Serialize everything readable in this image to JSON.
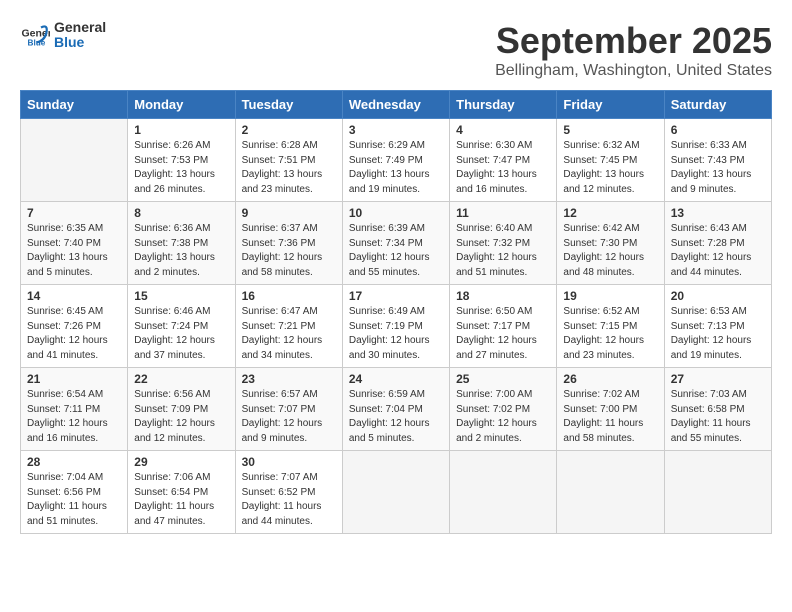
{
  "header": {
    "logo_general": "General",
    "logo_blue": "Blue",
    "month_title": "September 2025",
    "location": "Bellingham, Washington, United States"
  },
  "weekdays": [
    "Sunday",
    "Monday",
    "Tuesday",
    "Wednesday",
    "Thursday",
    "Friday",
    "Saturday"
  ],
  "weeks": [
    [
      {
        "day": "",
        "info": ""
      },
      {
        "day": "1",
        "info": "Sunrise: 6:26 AM\nSunset: 7:53 PM\nDaylight: 13 hours\nand 26 minutes."
      },
      {
        "day": "2",
        "info": "Sunrise: 6:28 AM\nSunset: 7:51 PM\nDaylight: 13 hours\nand 23 minutes."
      },
      {
        "day": "3",
        "info": "Sunrise: 6:29 AM\nSunset: 7:49 PM\nDaylight: 13 hours\nand 19 minutes."
      },
      {
        "day": "4",
        "info": "Sunrise: 6:30 AM\nSunset: 7:47 PM\nDaylight: 13 hours\nand 16 minutes."
      },
      {
        "day": "5",
        "info": "Sunrise: 6:32 AM\nSunset: 7:45 PM\nDaylight: 13 hours\nand 12 minutes."
      },
      {
        "day": "6",
        "info": "Sunrise: 6:33 AM\nSunset: 7:43 PM\nDaylight: 13 hours\nand 9 minutes."
      }
    ],
    [
      {
        "day": "7",
        "info": "Sunrise: 6:35 AM\nSunset: 7:40 PM\nDaylight: 13 hours\nand 5 minutes."
      },
      {
        "day": "8",
        "info": "Sunrise: 6:36 AM\nSunset: 7:38 PM\nDaylight: 13 hours\nand 2 minutes."
      },
      {
        "day": "9",
        "info": "Sunrise: 6:37 AM\nSunset: 7:36 PM\nDaylight: 12 hours\nand 58 minutes."
      },
      {
        "day": "10",
        "info": "Sunrise: 6:39 AM\nSunset: 7:34 PM\nDaylight: 12 hours\nand 55 minutes."
      },
      {
        "day": "11",
        "info": "Sunrise: 6:40 AM\nSunset: 7:32 PM\nDaylight: 12 hours\nand 51 minutes."
      },
      {
        "day": "12",
        "info": "Sunrise: 6:42 AM\nSunset: 7:30 PM\nDaylight: 12 hours\nand 48 minutes."
      },
      {
        "day": "13",
        "info": "Sunrise: 6:43 AM\nSunset: 7:28 PM\nDaylight: 12 hours\nand 44 minutes."
      }
    ],
    [
      {
        "day": "14",
        "info": "Sunrise: 6:45 AM\nSunset: 7:26 PM\nDaylight: 12 hours\nand 41 minutes."
      },
      {
        "day": "15",
        "info": "Sunrise: 6:46 AM\nSunset: 7:24 PM\nDaylight: 12 hours\nand 37 minutes."
      },
      {
        "day": "16",
        "info": "Sunrise: 6:47 AM\nSunset: 7:21 PM\nDaylight: 12 hours\nand 34 minutes."
      },
      {
        "day": "17",
        "info": "Sunrise: 6:49 AM\nSunset: 7:19 PM\nDaylight: 12 hours\nand 30 minutes."
      },
      {
        "day": "18",
        "info": "Sunrise: 6:50 AM\nSunset: 7:17 PM\nDaylight: 12 hours\nand 27 minutes."
      },
      {
        "day": "19",
        "info": "Sunrise: 6:52 AM\nSunset: 7:15 PM\nDaylight: 12 hours\nand 23 minutes."
      },
      {
        "day": "20",
        "info": "Sunrise: 6:53 AM\nSunset: 7:13 PM\nDaylight: 12 hours\nand 19 minutes."
      }
    ],
    [
      {
        "day": "21",
        "info": "Sunrise: 6:54 AM\nSunset: 7:11 PM\nDaylight: 12 hours\nand 16 minutes."
      },
      {
        "day": "22",
        "info": "Sunrise: 6:56 AM\nSunset: 7:09 PM\nDaylight: 12 hours\nand 12 minutes."
      },
      {
        "day": "23",
        "info": "Sunrise: 6:57 AM\nSunset: 7:07 PM\nDaylight: 12 hours\nand 9 minutes."
      },
      {
        "day": "24",
        "info": "Sunrise: 6:59 AM\nSunset: 7:04 PM\nDaylight: 12 hours\nand 5 minutes."
      },
      {
        "day": "25",
        "info": "Sunrise: 7:00 AM\nSunset: 7:02 PM\nDaylight: 12 hours\nand 2 minutes."
      },
      {
        "day": "26",
        "info": "Sunrise: 7:02 AM\nSunset: 7:00 PM\nDaylight: 11 hours\nand 58 minutes."
      },
      {
        "day": "27",
        "info": "Sunrise: 7:03 AM\nSunset: 6:58 PM\nDaylight: 11 hours\nand 55 minutes."
      }
    ],
    [
      {
        "day": "28",
        "info": "Sunrise: 7:04 AM\nSunset: 6:56 PM\nDaylight: 11 hours\nand 51 minutes."
      },
      {
        "day": "29",
        "info": "Sunrise: 7:06 AM\nSunset: 6:54 PM\nDaylight: 11 hours\nand 47 minutes."
      },
      {
        "day": "30",
        "info": "Sunrise: 7:07 AM\nSunset: 6:52 PM\nDaylight: 11 hours\nand 44 minutes."
      },
      {
        "day": "",
        "info": ""
      },
      {
        "day": "",
        "info": ""
      },
      {
        "day": "",
        "info": ""
      },
      {
        "day": "",
        "info": ""
      }
    ]
  ]
}
